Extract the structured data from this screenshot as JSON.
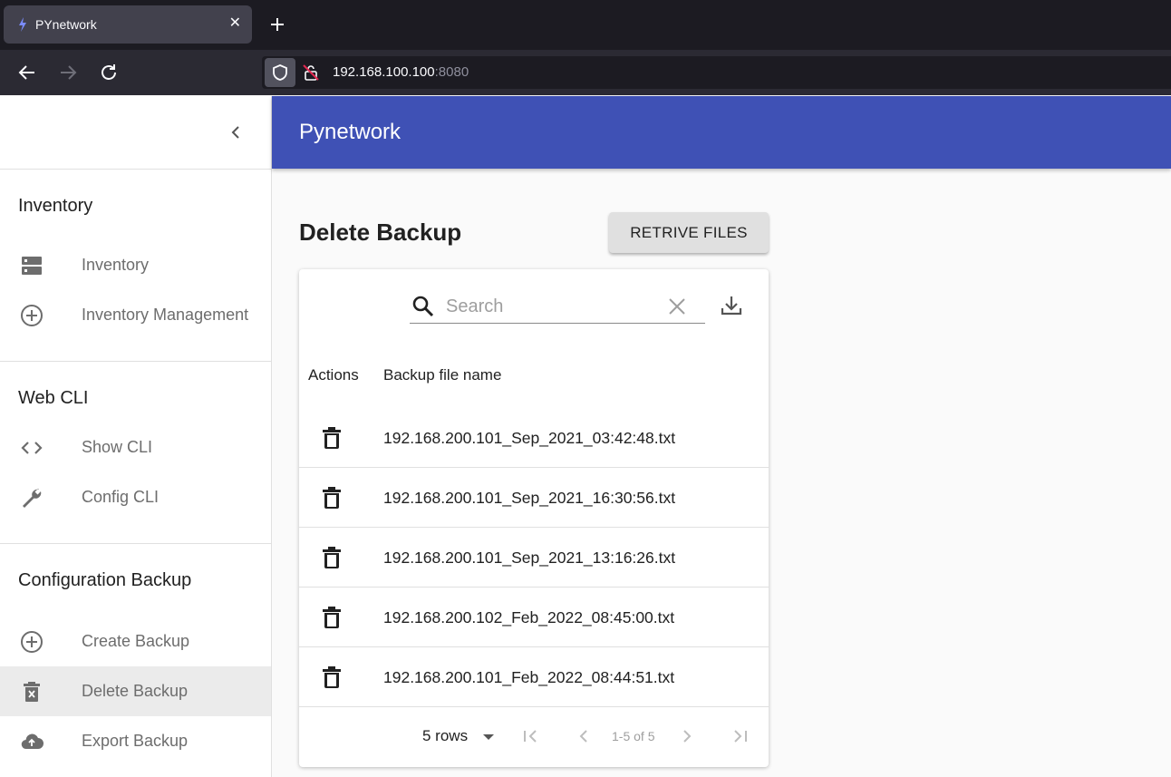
{
  "browser": {
    "tab_title": "PYnetwork",
    "url_host": "192.168.100.100",
    "url_port": ":8080"
  },
  "sidebar": {
    "sections": [
      {
        "title": "Inventory",
        "items": [
          {
            "label": "Inventory",
            "icon": "server-icon"
          },
          {
            "label": "Inventory Management",
            "icon": "add-circle-icon"
          }
        ]
      },
      {
        "title": "Web CLI",
        "items": [
          {
            "label": "Show CLI",
            "icon": "code-icon"
          },
          {
            "label": "Config CLI",
            "icon": "wrench-icon"
          }
        ]
      },
      {
        "title": "Configuration Backup",
        "items": [
          {
            "label": "Create Backup",
            "icon": "add-circle-icon"
          },
          {
            "label": "Delete Backup",
            "icon": "delete-forever-icon",
            "active": true
          },
          {
            "label": "Export Backup",
            "icon": "cloud-upload-icon"
          }
        ]
      }
    ]
  },
  "header": {
    "title": "Pynetwork"
  },
  "main": {
    "title": "Delete Backup",
    "retrieve_label": "RETRIVE FILES",
    "search_placeholder": "Search",
    "columns": [
      "Actions",
      "Backup file name"
    ],
    "rows": [
      "192.168.200.101_Sep_2021_03:42:48.txt",
      "192.168.200.101_Sep_2021_16:30:56.txt",
      "192.168.200.101_Sep_2021_13:16:26.txt",
      "192.168.200.102_Feb_2022_08:45:00.txt",
      "192.168.200.101_Feb_2022_08:44:51.txt"
    ],
    "pagination": {
      "rows_label": "5 rows",
      "range": "1-5 of 5"
    }
  },
  "colors": {
    "primary": "#3f51b5",
    "active_bg": "#ebebeb"
  }
}
